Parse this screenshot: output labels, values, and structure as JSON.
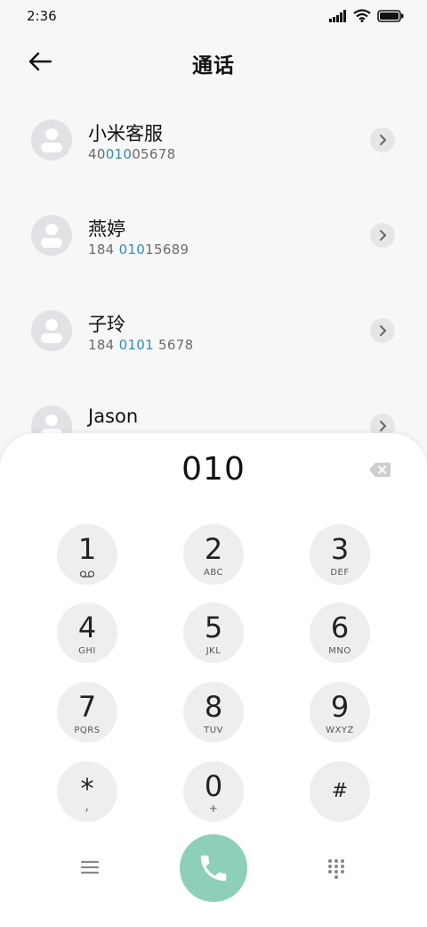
{
  "status_bar": {
    "time": "2:36"
  },
  "header": {
    "title": "通话"
  },
  "contacts": [
    {
      "name": "小米客服",
      "number_pre": "40",
      "number_hl": "010",
      "number_post": "05678"
    },
    {
      "name": "燕婷",
      "number_pre": "184 ",
      "number_hl": "010",
      "number_post": "15689"
    },
    {
      "name": "子玲",
      "number_pre": "184 ",
      "number_hl": "0101",
      "number_post": " 5678"
    },
    {
      "name": "Jason",
      "number_pre": "",
      "number_hl": "",
      "number_post": ""
    }
  ],
  "dialpad": {
    "display": "010",
    "keys": [
      {
        "digit": "1",
        "letters": "voicemail"
      },
      {
        "digit": "2",
        "letters": "ABC"
      },
      {
        "digit": "3",
        "letters": "DEF"
      },
      {
        "digit": "4",
        "letters": "GHI"
      },
      {
        "digit": "5",
        "letters": "JKL"
      },
      {
        "digit": "6",
        "letters": "MNO"
      },
      {
        "digit": "7",
        "letters": "PQRS"
      },
      {
        "digit": "8",
        "letters": "TUV"
      },
      {
        "digit": "9",
        "letters": "WXYZ"
      },
      {
        "digit": "*",
        "letters": ","
      },
      {
        "digit": "0",
        "letters": "+"
      },
      {
        "digit": "#",
        "letters": ""
      }
    ]
  },
  "colors": {
    "highlight": "#2d8fb4",
    "call_button": "#8ecfb7",
    "key_bg": "#eeeeee",
    "avatar_bg": "#e1e2e6"
  },
  "icons": {
    "back": "arrow-left-icon",
    "chevron": "chevron-right-icon",
    "backspace": "backspace-icon",
    "voicemail": "voicemail-icon",
    "menu": "menu-icon",
    "call": "phone-icon",
    "keypad": "dialpad-icon"
  }
}
